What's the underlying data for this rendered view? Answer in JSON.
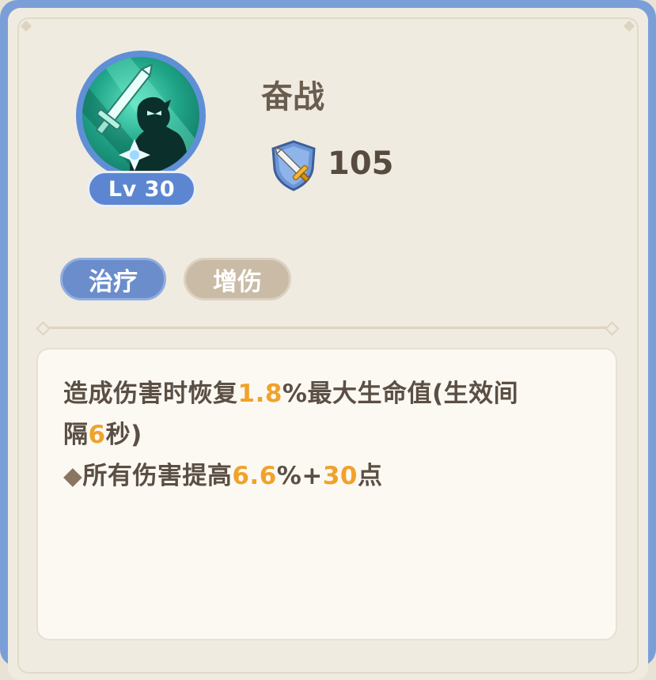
{
  "skill": {
    "name": "奋战",
    "level_label": "Lv 30",
    "power_value": "105",
    "icon": "sword-warrior-icon",
    "power_icon": "sword-shield-icon"
  },
  "tags": [
    {
      "label": "治疗",
      "color": "#6b8dcc"
    },
    {
      "label": "增伤",
      "color": "#c9bba5"
    }
  ],
  "description": {
    "line1": {
      "t1": "造成伤害时恢复",
      "v1": "1.8",
      "t2": "%最大生命值(生效间"
    },
    "line2": {
      "t1": "隔",
      "v1": "6",
      "t2": "秒)"
    },
    "line3": {
      "bullet": "◆",
      "t1": "所有伤害提高",
      "v1": "6.6",
      "t2": "%+",
      "v2": "30",
      "t3": "点"
    }
  },
  "colors": {
    "frame": "#7a9fd8",
    "panel": "#f0ebe0",
    "highlight": "#f0a22a",
    "text": "#5b4f44"
  }
}
